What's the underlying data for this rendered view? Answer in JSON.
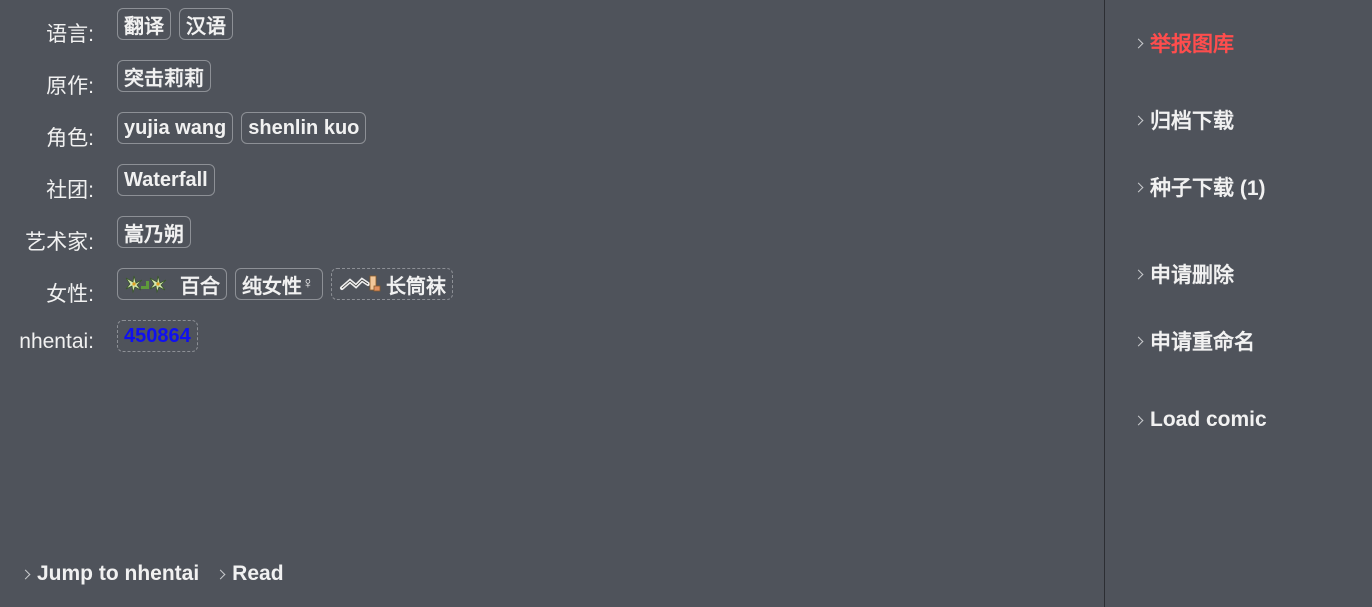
{
  "tags": {
    "language": {
      "label": "语言:",
      "items": [
        "翻译",
        "汉语"
      ]
    },
    "parody": {
      "label": "原作:",
      "items": [
        "突击莉莉"
      ]
    },
    "character": {
      "label": "角色:",
      "items": [
        "yujia wang",
        "shenlin kuo"
      ]
    },
    "group": {
      "label": "社团:",
      "items": [
        "Waterfall"
      ]
    },
    "artist": {
      "label": "艺术家:",
      "items": [
        "嵩乃朔"
      ]
    },
    "female": {
      "label": "女性:",
      "items": [
        {
          "text": "百合",
          "icon": "lily-flower-icon"
        },
        {
          "text": "纯女性",
          "icon": "female-symbol-icon",
          "symbol": "♀"
        },
        {
          "text": "长筒袜",
          "icon": "stockings-icon"
        }
      ]
    },
    "nhentai": {
      "label": "nhentai:",
      "items": [
        "450864"
      ],
      "link_color": "#1010f0"
    }
  },
  "bottom_links": {
    "jump": "Jump to nhentai",
    "read": "Read"
  },
  "side_menu": {
    "report": "举报图库",
    "archive": "归档下载",
    "torrent": "种子下载 (1)",
    "delete": "申请删除",
    "rename": "申请重命名",
    "load": "Load comic"
  },
  "colors": {
    "background": "#4f535b",
    "report_red": "#ff4d4d",
    "tag_border": "#8d9096"
  }
}
